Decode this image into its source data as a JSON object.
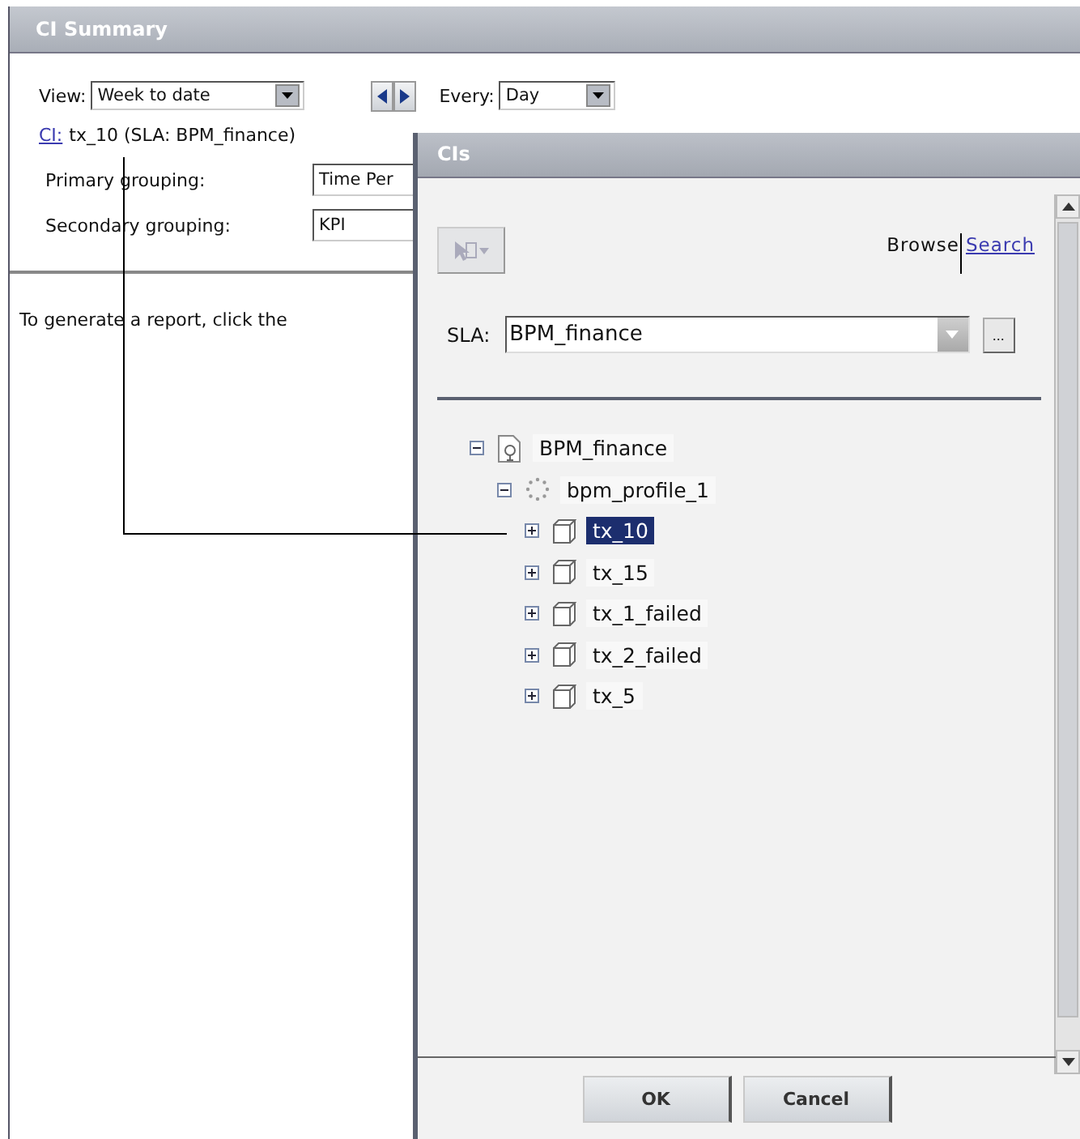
{
  "main": {
    "title": "CI Summary",
    "view_label": "View:",
    "view_value": "Week to date",
    "every_label": "Every:",
    "every_value": "Day",
    "ci_link": "CI:",
    "ci_text": "tx_10 (SLA: BPM_finance)",
    "primary_label": "Primary grouping:",
    "primary_value": "Time Per",
    "secondary_label": "Secondary grouping:",
    "secondary_value": "KPI",
    "hint": "To generate a report, click the"
  },
  "dialog": {
    "title": "CIs",
    "modes": [
      {
        "label": "Browse",
        "selected": true
      },
      {
        "label": "Search",
        "selected": false
      }
    ],
    "sla_label": "SLA:",
    "sla_value": "BPM_finance",
    "more_button": "...",
    "tree": [
      {
        "label": "BPM_finance",
        "kind": "sla",
        "expanded": true,
        "selected": false,
        "children": [
          {
            "label": "bpm_profile_1",
            "kind": "profile",
            "expanded": true,
            "selected": false,
            "children": [
              {
                "label": "tx_10",
                "kind": "transaction",
                "expanded": false,
                "selected": true
              },
              {
                "label": "tx_15",
                "kind": "transaction",
                "expanded": false,
                "selected": false
              },
              {
                "label": "tx_1_failed",
                "kind": "transaction",
                "expanded": false,
                "selected": false
              },
              {
                "label": "tx_2_failed",
                "kind": "transaction",
                "expanded": false,
                "selected": false
              },
              {
                "label": "tx_5",
                "kind": "transaction",
                "expanded": false,
                "selected": false
              }
            ]
          }
        ]
      }
    ],
    "buttons": [
      "OK",
      "Cancel"
    ]
  }
}
